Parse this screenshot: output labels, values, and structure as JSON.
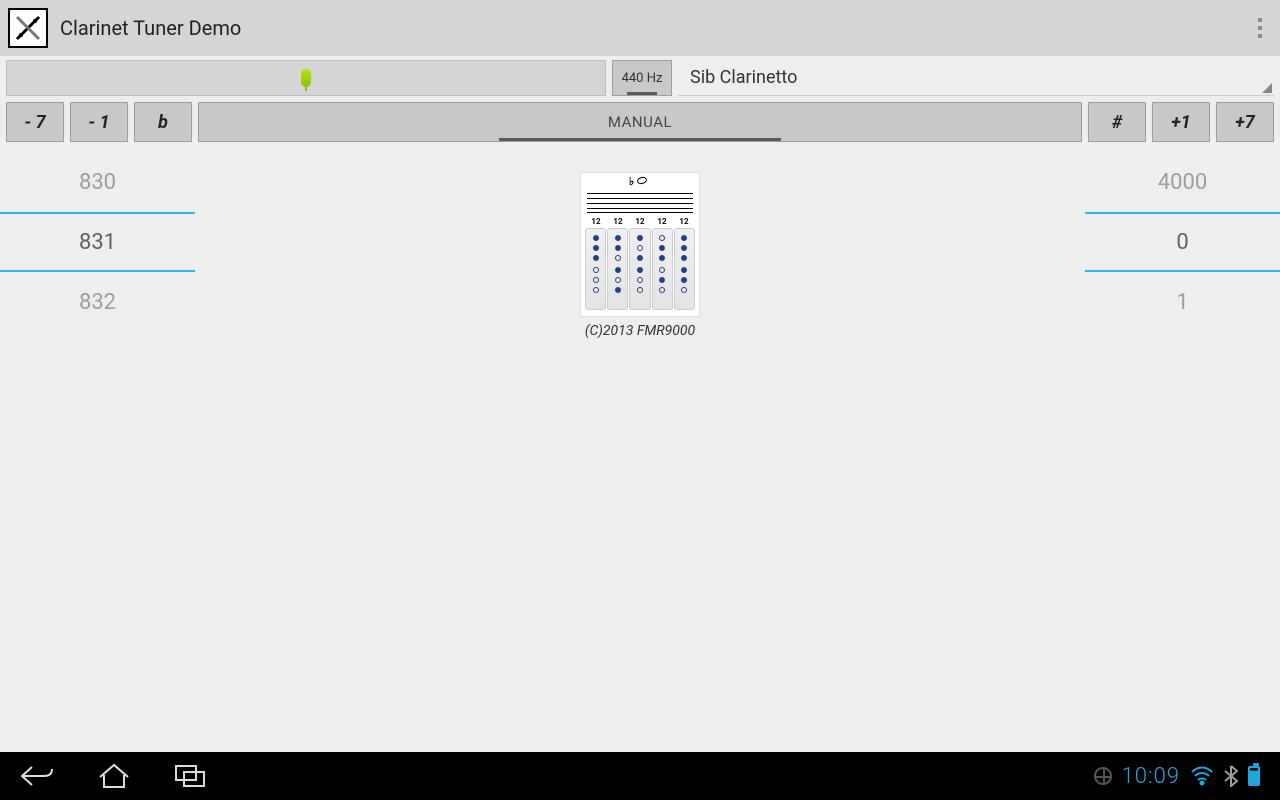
{
  "app": {
    "title": "Clarinet Tuner Demo"
  },
  "controls": {
    "hz_label": "440 Hz",
    "instrument": "Sib Clarinetto",
    "minus7": "- 7",
    "minus1": "- 1",
    "flat": "b",
    "manual": "MANUAL",
    "sharp": "#",
    "plus1": "+1",
    "plus7": "+7"
  },
  "left_spinner": {
    "prev": "830",
    "sel": "831",
    "next": "832"
  },
  "right_spinner": {
    "prev": "4000",
    "sel": "0",
    "next": "1"
  },
  "chart": {
    "finger_labels": [
      "12",
      "12",
      "12",
      "12",
      "12"
    ],
    "copyright": "(C)2013 FMR9000"
  },
  "status": {
    "time": "10:09"
  }
}
